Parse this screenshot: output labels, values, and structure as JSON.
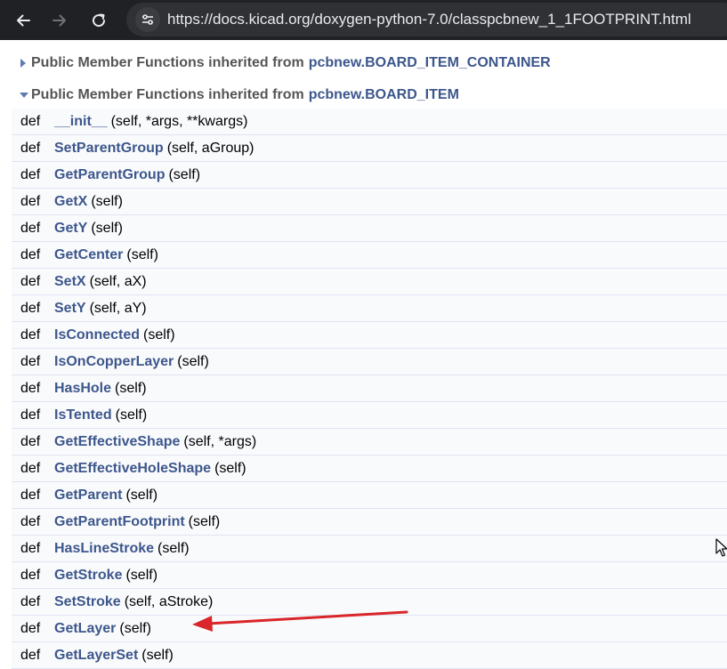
{
  "browser": {
    "url": "https://docs.kicad.org/doxygen-python-7.0/classpcbnew_1_1FOOTPRINT.html",
    "icons": {
      "back": "arrow-left-icon",
      "forward": "arrow-right-icon",
      "reload": "reload-icon",
      "site_info": "tune-icon"
    }
  },
  "sections": [
    {
      "prefix": "Public Member Functions inherited from",
      "class_name": "pcbnew.BOARD_ITEM_CONTAINER",
      "state": "collapsed"
    },
    {
      "prefix": "Public Member Functions inherited from",
      "class_name": "pcbnew.BOARD_ITEM",
      "state": "expanded"
    }
  ],
  "members": [
    {
      "def": "def",
      "name": "__init__",
      "args": "(self, *args, **kwargs)"
    },
    {
      "def": "def",
      "name": "SetParentGroup",
      "args": "(self, aGroup)"
    },
    {
      "def": "def",
      "name": "GetParentGroup",
      "args": "(self)"
    },
    {
      "def": "def",
      "name": "GetX",
      "args": "(self)"
    },
    {
      "def": "def",
      "name": "GetY",
      "args": "(self)"
    },
    {
      "def": "def",
      "name": "GetCenter",
      "args": "(self)"
    },
    {
      "def": "def",
      "name": "SetX",
      "args": "(self, aX)"
    },
    {
      "def": "def",
      "name": "SetY",
      "args": "(self, aY)"
    },
    {
      "def": "def",
      "name": "IsConnected",
      "args": "(self)"
    },
    {
      "def": "def",
      "name": "IsOnCopperLayer",
      "args": "(self)"
    },
    {
      "def": "def",
      "name": "HasHole",
      "args": "(self)"
    },
    {
      "def": "def",
      "name": "IsTented",
      "args": "(self)"
    },
    {
      "def": "def",
      "name": "GetEffectiveShape",
      "args": "(self, *args)"
    },
    {
      "def": "def",
      "name": "GetEffectiveHoleShape",
      "args": "(self)"
    },
    {
      "def": "def",
      "name": "GetParent",
      "args": "(self)"
    },
    {
      "def": "def",
      "name": "GetParentFootprint",
      "args": "(self)"
    },
    {
      "def": "def",
      "name": "HasLineStroke",
      "args": "(self)"
    },
    {
      "def": "def",
      "name": "GetStroke",
      "args": "(self)"
    },
    {
      "def": "def",
      "name": "SetStroke",
      "args": "(self, aStroke)"
    },
    {
      "def": "def",
      "name": "GetLayer",
      "args": "(self)"
    },
    {
      "def": "def",
      "name": "GetLayerSet",
      "args": "(self)"
    }
  ],
  "annotation": {
    "type": "red-arrow",
    "points_to": "GetLayer",
    "color": "#d9262a"
  },
  "colors": {
    "link": "#3d578c",
    "header_text": "#555555",
    "row_bg": "#f9fafc",
    "row_border": "#dee4f0",
    "toolbar": "#202124",
    "urlbar": "#303134"
  }
}
